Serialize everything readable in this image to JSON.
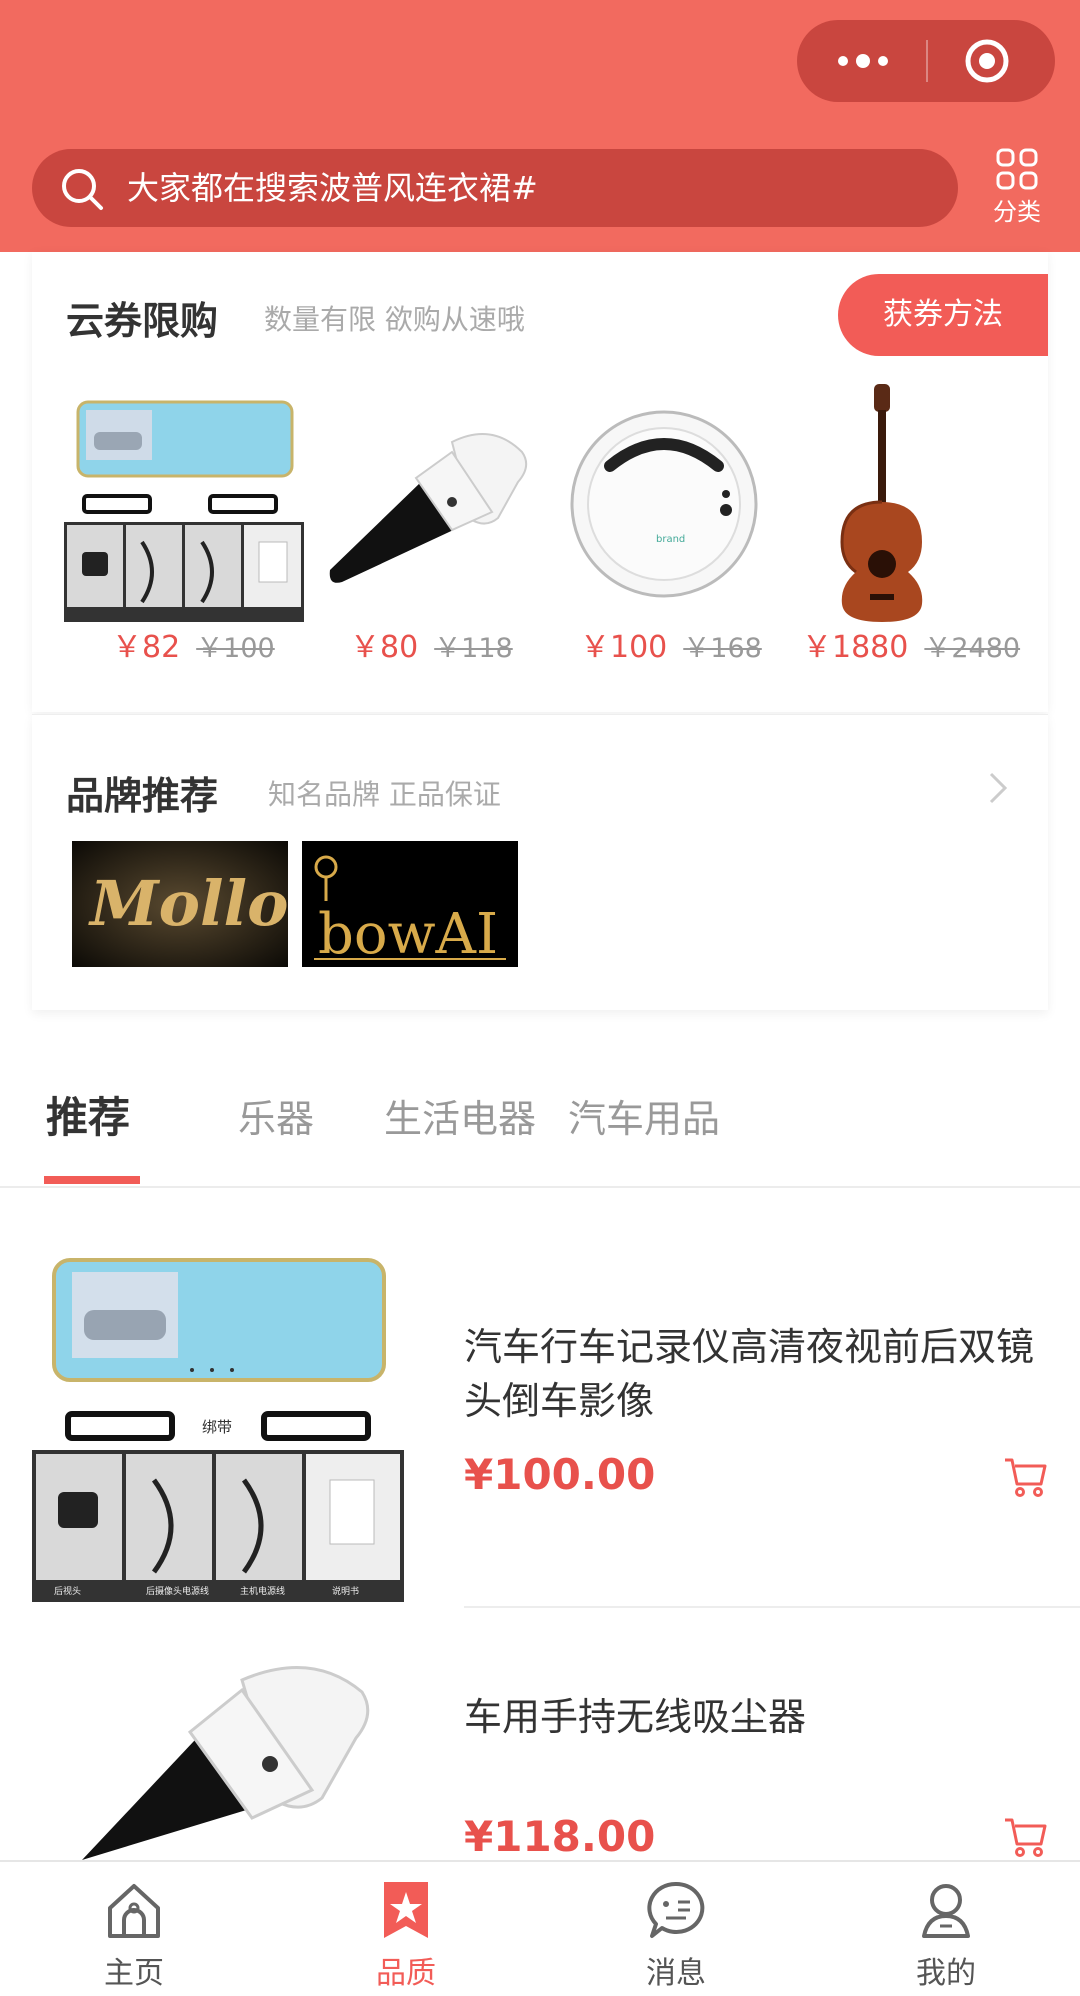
{
  "colors": {
    "primary": "#f26a5f",
    "accent": "#f25c57",
    "price": "#e8514c"
  },
  "header": {
    "search_placeholder": "大家都在搜索波普风连衣裙#",
    "category_label": "分类",
    "capsule_icons": [
      "more-dots-icon",
      "target-icon"
    ]
  },
  "coupon": {
    "title": "云券限购",
    "subtitle": "数量有限 欲购从速哦",
    "button": "获券方法",
    "products": [
      {
        "icon": "dashcam-mirror",
        "price": "￥82",
        "old_price": "￥100"
      },
      {
        "icon": "handheld-vacuum",
        "price": "￥80",
        "old_price": "￥118"
      },
      {
        "icon": "robot-vacuum",
        "price": "￥100",
        "old_price": "￥168"
      },
      {
        "icon": "acoustic-guitar",
        "price": "￥1880",
        "old_price": "￥2480"
      }
    ]
  },
  "brands": {
    "title": "品牌推荐",
    "subtitle": "知名品牌 正品保证",
    "logos": [
      {
        "text": "Mollo"
      },
      {
        "text": "bowAI"
      }
    ]
  },
  "tabs": [
    "推荐",
    "乐器",
    "生活电器",
    "汽车用品"
  ],
  "thumb_labels": {
    "strap": "绑带",
    "cells": [
      "后视头",
      "后摄像头电源线",
      "主机电源线",
      "说明书"
    ]
  },
  "items": [
    {
      "name": "汽车行车记录仪高清夜视前后双镜头倒车影像",
      "price": "¥100.00",
      "icon": "dashcam-mirror"
    },
    {
      "name": "车用手持无线吸尘器",
      "price": "¥118.00",
      "icon": "handheld-vacuum"
    }
  ],
  "nav": [
    {
      "label": "主页",
      "icon": "home-icon",
      "active": false
    },
    {
      "label": "品质",
      "icon": "quality-star-icon",
      "active": true
    },
    {
      "label": "消息",
      "icon": "message-icon",
      "active": false
    },
    {
      "label": "我的",
      "icon": "profile-icon",
      "active": false
    }
  ]
}
